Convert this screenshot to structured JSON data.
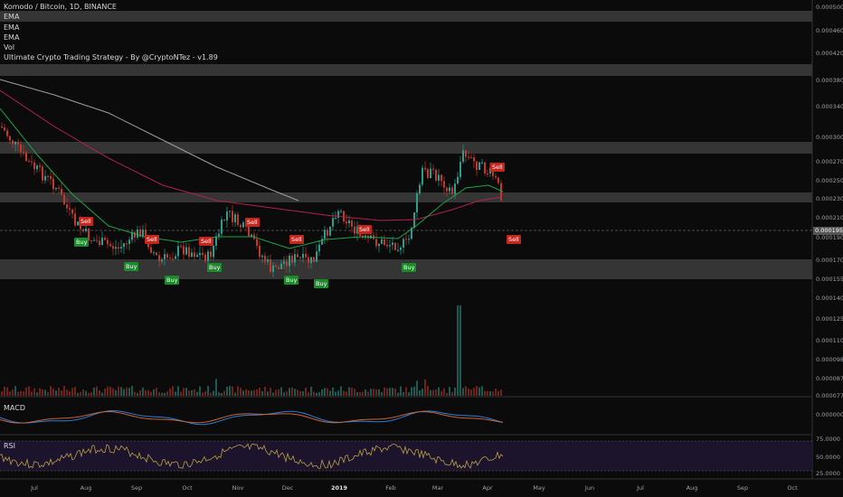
{
  "title": "Komodo / Bitcoin, 1D, BINANCE",
  "indicators": [
    "EMA",
    "EMA",
    "EMA",
    "Vol"
  ],
  "strategy_label": "Ultimate Crypto Trading Strategy - By @CryptoNTez - v1.89",
  "current_price": "0.0001954",
  "price_axis": [
    "0.0005000",
    "0.0004600",
    "0.0004200",
    "0.0003800",
    "0.0003400",
    "0.0003000",
    "0.0002700",
    "0.0002500",
    "0.0002300",
    "0.0002100",
    "0.0001900",
    "0.0001700",
    "0.0001550",
    "0.0001400",
    "0.0001250",
    "0.0001100",
    "0.0000980",
    "0.0000870",
    "0.0000770"
  ],
  "time_axis": [
    "Jul",
    "Aug",
    "Sep",
    "Oct",
    "Nov",
    "Dec",
    "2019",
    "Feb",
    "Mar",
    "Apr",
    "May",
    "Jun",
    "Jul",
    "Aug",
    "Sep",
    "Oct"
  ],
  "macd": {
    "label": "MACD",
    "axis": "0.0000000"
  },
  "rsi": {
    "label": "RSI",
    "axis": [
      "75.0000",
      "50.0000",
      "25.0000"
    ]
  },
  "signals": [
    {
      "type": "sell",
      "text": "Sell"
    },
    {
      "type": "buy",
      "text": "Buy"
    },
    {
      "type": "buy",
      "text": "Buy"
    },
    {
      "type": "sell",
      "text": "Sell"
    },
    {
      "type": "buy",
      "text": "Buy"
    },
    {
      "type": "sell",
      "text": "Sell"
    },
    {
      "type": "buy",
      "text": "Buy"
    },
    {
      "type": "sell",
      "text": "Sell"
    },
    {
      "type": "sell",
      "text": "Sell"
    },
    {
      "type": "buy",
      "text": "Buy"
    },
    {
      "type": "buy",
      "text": "Buy"
    },
    {
      "type": "sell",
      "text": "Sell"
    },
    {
      "type": "buy",
      "text": "Buy"
    },
    {
      "type": "sell",
      "text": "Sell"
    },
    {
      "type": "sell",
      "text": "Sell"
    }
  ],
  "colors": {
    "up": "#2a9d8f",
    "down": "#c0392b",
    "ema_fast": "#1aa34a",
    "ema_mid": "#b0224a",
    "ema_slow": "#9e9e9e",
    "macd": "#2f7fd6",
    "signal": "#c8643a",
    "rsi": "#b9a040",
    "zone": "#5a5a5a"
  }
}
